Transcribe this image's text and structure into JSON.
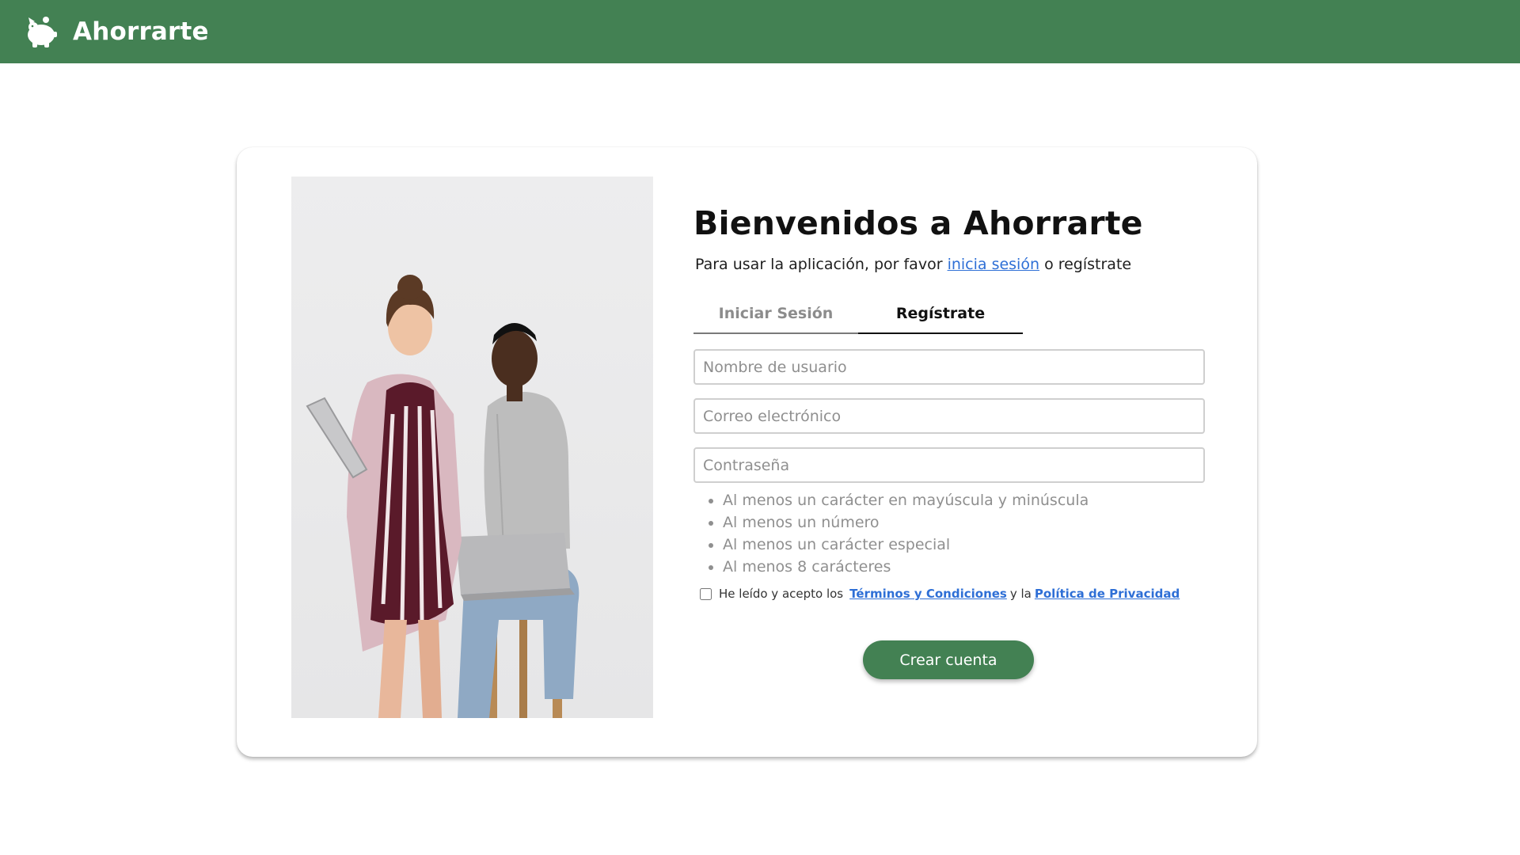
{
  "header": {
    "brand_name": "Ahorrarte",
    "logo_icon": "piggy-bank-icon",
    "brand_color": "#438153"
  },
  "welcome": {
    "title": "Bienvenidos a Ahorrarte",
    "subtitle_before": "Para usar la aplicación, por favor",
    "subtitle_link": "inicia sesión",
    "subtitle_after": "o regístrate"
  },
  "tabs": {
    "login": "Iniciar Sesión",
    "register": "Regístrate",
    "active": "register"
  },
  "form": {
    "username_placeholder": "Nombre de usuario",
    "email_placeholder": "Correo electrónico",
    "password_placeholder": "Contraseña",
    "password_rules": [
      "Al menos un carácter en mayúscula y minúscula",
      "Al menos un número",
      "Al menos un carácter especial",
      "Al menos 8 carácteres"
    ],
    "terms_prefix": "He leído y acepto los",
    "terms_link": "Términos y Condiciones",
    "terms_middle": "y la",
    "privacy_link": "Política de Privacidad",
    "terms_checked": false,
    "submit_label": "Crear cuenta"
  },
  "colors": {
    "primary": "#438153",
    "link": "#2e6fd6"
  }
}
